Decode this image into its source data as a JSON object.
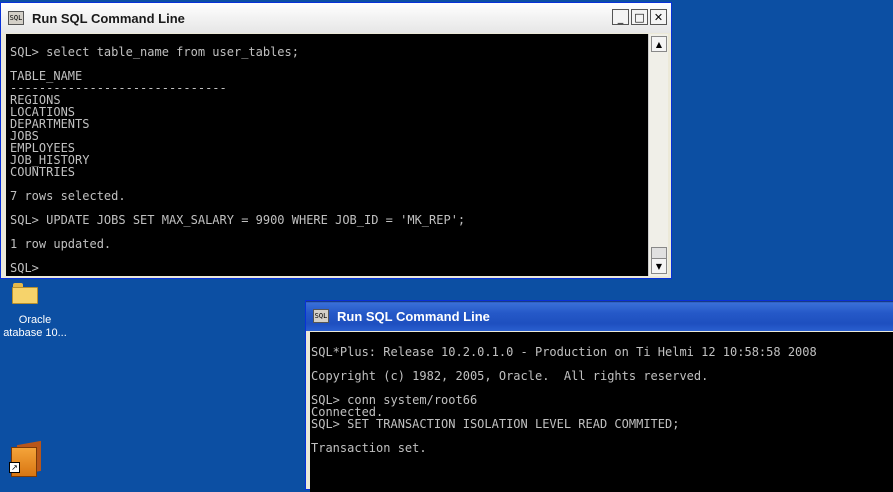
{
  "window1": {
    "title": "Run SQL Command Line",
    "app_icon_text": "SQL",
    "controls": [
      "_",
      "□",
      "✕"
    ],
    "lines": [
      "SQL> select table_name from user_tables;",
      "",
      "TABLE_NAME",
      "------------------------------",
      "REGIONS",
      "LOCATIONS",
      "DEPARTMENTS",
      "JOBS",
      "EMPLOYEES",
      "JOB_HISTORY",
      "COUNTRIES",
      "",
      "7 rows selected.",
      "",
      "SQL> UPDATE JOBS SET MAX_SALARY = 9900 WHERE JOB_ID = 'MK_REP';",
      "",
      "1 row updated.",
      "",
      "SQL>"
    ]
  },
  "window2": {
    "title": "Run SQL Command Line",
    "app_icon_text": "SQL",
    "lines": [
      "SQL*Plus: Release 10.2.0.1.0 - Production on Ti Helmi 12 10:58:58 2008",
      "",
      "Copyright (c) 1982, 2005, Oracle.  All rights reserved.",
      "",
      "SQL> conn system/root66",
      "Connected.",
      "SQL> SET TRANSACTION ISOLATION LEVEL READ COMMITED;",
      "",
      "Transaction set."
    ]
  },
  "desktop": {
    "folder_label_1": "Oracle",
    "folder_label_2": "atabase 10..."
  },
  "colors": {
    "desktop": "#0c4fa3",
    "console_bg": "#000000",
    "console_text": "#c0c0c0",
    "active_title": "#2559c8"
  },
  "icons": {
    "scroll_up": "triangle-up-icon",
    "scroll_down": "triangle-down-icon",
    "folder": "folder-icon",
    "box": "package-icon"
  }
}
